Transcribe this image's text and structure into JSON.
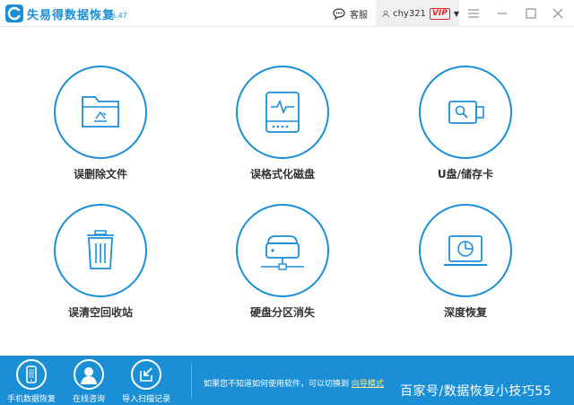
{
  "app": {
    "title": "失易得数据恢复",
    "version": "6.47",
    "accent_color": "#1a8fd6"
  },
  "header": {
    "service_label": "客服",
    "service_icon": "chat-bubble-icon",
    "username": "chy321",
    "vip_badge": "VIP",
    "window_controls": [
      "menu-icon",
      "minimize-icon",
      "maximize-icon",
      "close-icon"
    ]
  },
  "features": [
    {
      "label": "误删除文件",
      "icon": "folder-recycle-icon"
    },
    {
      "label": "误格式化磁盘",
      "icon": "disk-icon"
    },
    {
      "label": "U盘/储存卡",
      "icon": "usb-drive-icon"
    },
    {
      "label": "误清空回收站",
      "icon": "trash-icon"
    },
    {
      "label": "硬盘分区消失",
      "icon": "partition-drive-icon"
    },
    {
      "label": "深度恢复",
      "icon": "deep-scan-laptop-icon"
    }
  ],
  "bottom_bar": {
    "buttons": [
      {
        "label": "手机数据恢复",
        "icon": "phone-icon"
      },
      {
        "label": "在线咨询",
        "icon": "person-icon"
      },
      {
        "label": "导入扫描记录",
        "icon": "import-icon"
      }
    ],
    "hint_text": "如果您不知道如何使用软件，可以切换到",
    "hint_link": "向导模式",
    "watermark": "百家号/数据恢复小技巧55"
  }
}
